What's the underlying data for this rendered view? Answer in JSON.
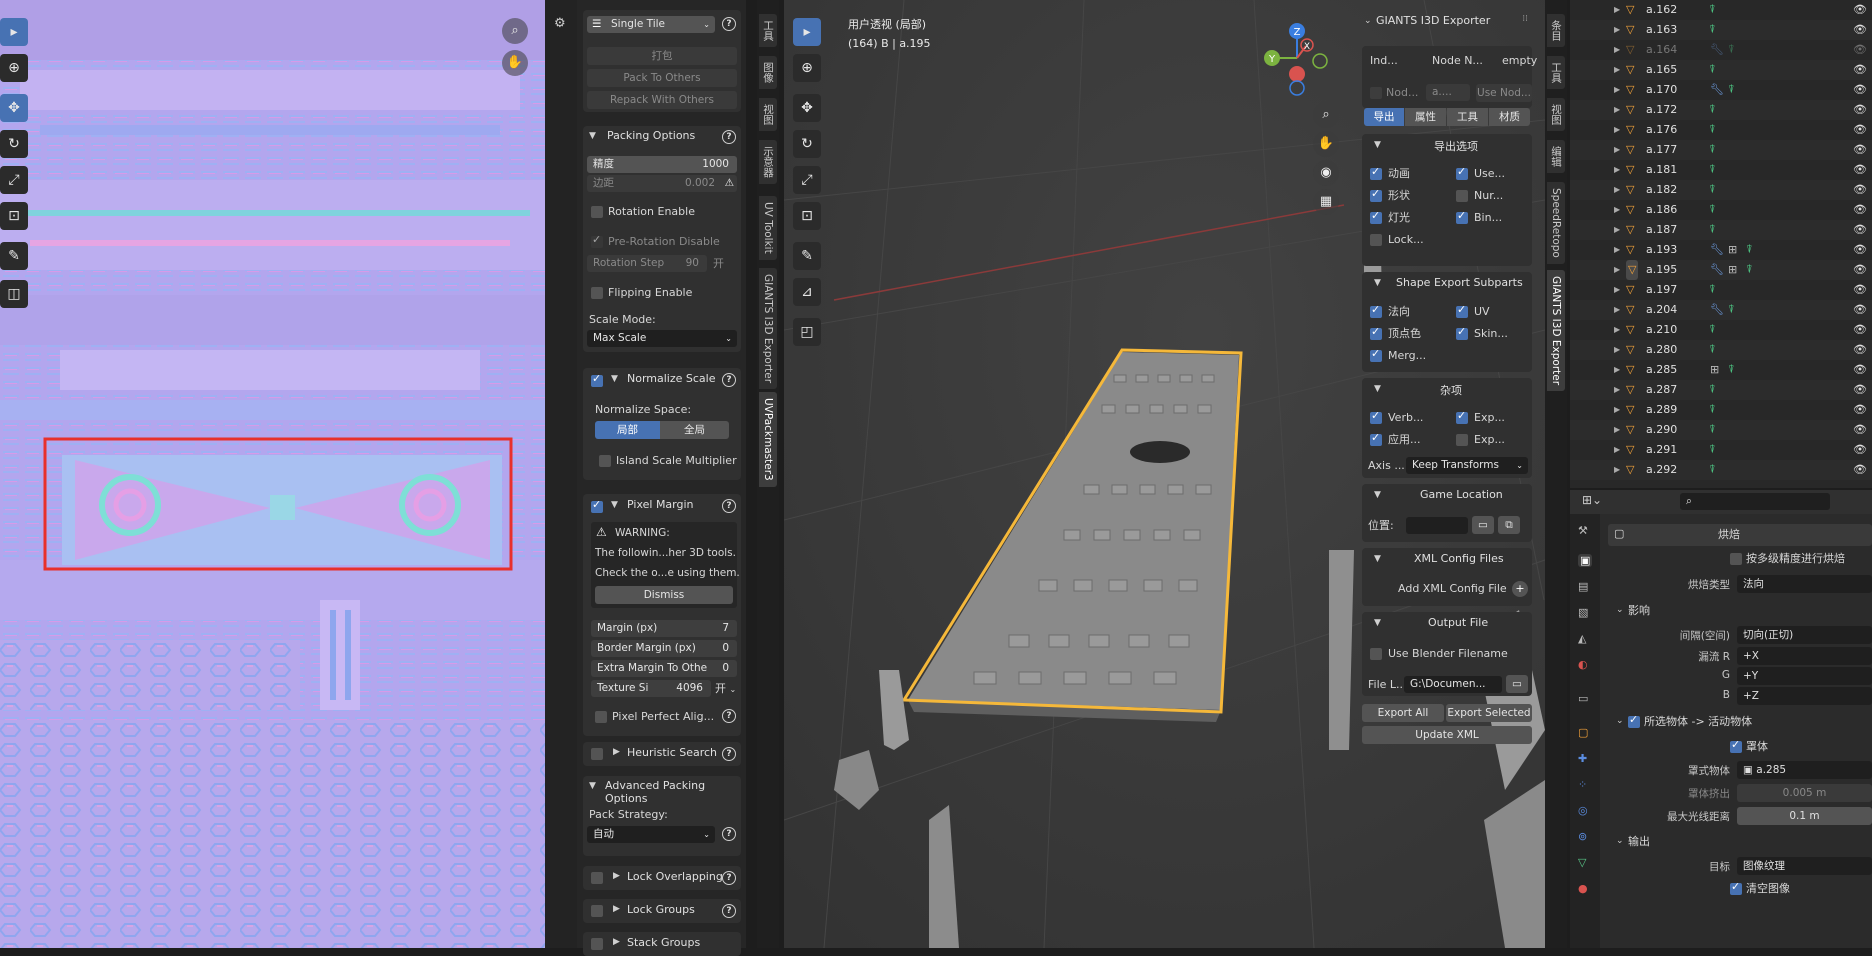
{
  "uv_panel": {
    "mode_select": "Single Tile",
    "pack_btn": "打包",
    "pack_to_others": "Pack To Others",
    "repack_with_others": "Repack With Others",
    "packing_options": {
      "title": "Packing Options",
      "precision_label": "精度",
      "precision_value": "1000",
      "margin_label": "边距",
      "margin_value": "0.002",
      "rotation_enable": "Rotation Enable",
      "pre_rotation_disable": "Pre-Rotation Disable",
      "rotation_step_label": "Rotation Step",
      "rotation_step_value": "90",
      "rotation_step_toggle": "开",
      "flipping_enable": "Flipping Enable",
      "scale_mode_label": "Scale Mode:",
      "scale_mode_value": "Max Scale"
    },
    "normalize_scale": {
      "title": "Normalize Scale",
      "space_label": "Normalize Space:",
      "local": "局部",
      "global": "全局",
      "island_multiplier": "Island Scale Multiplier"
    },
    "pixel_margin": {
      "title": "Pixel Margin",
      "warning_title": "WARNING:",
      "warning_line1": "The followin...her 3D tools.",
      "warning_line2": "Check the o...e using them.",
      "dismiss": "Dismiss",
      "margin_label": "Margin (px)",
      "margin_value": "7",
      "border_label": "Border Margin (px)",
      "border_value": "0",
      "extra_label": "Extra Margin To Othe",
      "extra_value": "0",
      "texture_label": "Texture Si",
      "texture_value": "4096",
      "texture_toggle": "开",
      "pixel_perfect": "Pixel Perfect Alig..."
    },
    "heuristic_search": "Heuristic Search",
    "advanced": {
      "title": "Advanced Packing Options",
      "strategy_label": "Pack Strategy:",
      "strategy_value": "自动"
    },
    "lock_overlapping": "Lock Overlapping",
    "lock_groups": "Lock Groups",
    "stack_groups": "Stack Groups"
  },
  "uv_tabs": [
    "工具",
    "图像",
    "视图",
    "示意器",
    "UV Toolkit",
    "GIANTS I3D Exporter",
    "UVPackmaster3"
  ],
  "viewport": {
    "view_name": "用户透视 (局部)",
    "object_info": "(164) B | a.195",
    "gizmo_labels": {
      "x": "X",
      "y": "Y",
      "z": "Z"
    }
  },
  "giants": {
    "title": "GIANTS I3D Exporter",
    "col_index": "Ind...",
    "col_node": "Node N...",
    "col_empty": "empty",
    "node_cb": "Nod...",
    "node_field": "a....",
    "use_node": "Use Nod...",
    "tabs": [
      "导出",
      "属性",
      "工具",
      "材质"
    ],
    "export_options_title": "导出选项",
    "export_options": [
      {
        "label": "动画",
        "on": true
      },
      {
        "label": "Use...",
        "on": true
      },
      {
        "label": "形状",
        "on": true
      },
      {
        "label": "Nur...",
        "on": false
      },
      {
        "label": "灯光",
        "on": true
      },
      {
        "label": "Bin...",
        "on": true
      },
      {
        "label": "Lock...",
        "on": false
      }
    ],
    "shape_title": "Shape Export Subparts",
    "shape_options": [
      {
        "label": "法向",
        "on": true
      },
      {
        "label": "UV",
        "on": true
      },
      {
        "label": "顶点色",
        "on": true
      },
      {
        "label": "Skin...",
        "on": true
      },
      {
        "label": "Merg...",
        "on": true
      }
    ],
    "misc_title": "杂项",
    "misc_options": [
      {
        "label": "Verb...",
        "on": true
      },
      {
        "label": "Exp...",
        "on": true
      },
      {
        "label": "应用...",
        "on": true
      },
      {
        "label": "Exp...",
        "on": false
      }
    ],
    "axis_label": "Axis ...",
    "axis_value": "Keep Transforms",
    "game_location_title": "Game Location",
    "position_label": "位置:",
    "xml_title": "XML Config Files",
    "add_xml": "Add XML Config File",
    "output_title": "Output File",
    "use_blender_filename": "Use Blender Filename",
    "file_label": "File L...",
    "file_value": "G:\\Documen...",
    "export_all": "Export All",
    "export_selected": "Export Selected",
    "update_xml": "Update XML"
  },
  "vp_tabs": [
    "条目",
    "工具",
    "视图",
    "编辑",
    "SpeedRetopo",
    "GIANTS I3D Exporter"
  ],
  "outliner": {
    "items": [
      {
        "name": "a.162",
        "dim": false,
        "mods": ""
      },
      {
        "name": "a.163",
        "dim": false,
        "mods": ""
      },
      {
        "name": "a.164",
        "dim": true,
        "mods": "wrench"
      },
      {
        "name": "a.165",
        "dim": false,
        "mods": ""
      },
      {
        "name": "a.170",
        "dim": false,
        "mods": "wrench"
      },
      {
        "name": "a.172",
        "dim": false,
        "mods": ""
      },
      {
        "name": "a.176",
        "dim": false,
        "mods": ""
      },
      {
        "name": "a.177",
        "dim": false,
        "mods": ""
      },
      {
        "name": "a.181",
        "dim": false,
        "mods": ""
      },
      {
        "name": "a.182",
        "dim": false,
        "mods": ""
      },
      {
        "name": "a.186",
        "dim": false,
        "mods": ""
      },
      {
        "name": "a.187",
        "dim": false,
        "mods": ""
      },
      {
        "name": "a.193",
        "dim": false,
        "mods": "wrench-grid"
      },
      {
        "name": "a.195",
        "dim": false,
        "mods": "wrench-grid",
        "active": true
      },
      {
        "name": "a.197",
        "dim": false,
        "mods": ""
      },
      {
        "name": "a.204",
        "dim": false,
        "mods": "wrench"
      },
      {
        "name": "a.210",
        "dim": false,
        "mods": ""
      },
      {
        "name": "a.280",
        "dim": false,
        "mods": ""
      },
      {
        "name": "a.285",
        "dim": false,
        "mods": "grid"
      },
      {
        "name": "a.287",
        "dim": false,
        "mods": ""
      },
      {
        "name": "a.289",
        "dim": false,
        "mods": ""
      },
      {
        "name": "a.290",
        "dim": false,
        "mods": ""
      },
      {
        "name": "a.291",
        "dim": false,
        "mods": ""
      },
      {
        "name": "a.292",
        "dim": false,
        "mods": ""
      }
    ]
  },
  "properties": {
    "bake_title": "烘焙",
    "multires": "按多级精度进行烘焙",
    "bake_type_label": "烘焙类型",
    "bake_type_value": "法向",
    "influence_title": "影响",
    "space_label": "间隔(空间)",
    "space_value": "切向(正切)",
    "swizzle_r_label": "漏流 R",
    "swizzle_r_value": "+X",
    "swizzle_g_label": "G",
    "swizzle_g_value": "+Y",
    "swizzle_b_label": "B",
    "swizzle_b_value": "+Z",
    "selected_to_active": "所选物体 -> 活动物体",
    "cage": "罩体",
    "cage_object_label": "罩式物体",
    "cage_object_value": "a.285",
    "cage_extrusion_label": "罩体挤出",
    "cage_extrusion_value": "0.005 m",
    "max_ray_label": "最大光线距离",
    "max_ray_value": "0.1 m",
    "output_title": "输出",
    "target_label": "目标",
    "target_value": "图像纹理",
    "clear_image": "清空图像"
  },
  "colors": {
    "accent": "#4772b3",
    "selection_outline": "#f5b83a",
    "uv_highlight": "#e8302b",
    "uv_base": "#b5a7ec"
  }
}
